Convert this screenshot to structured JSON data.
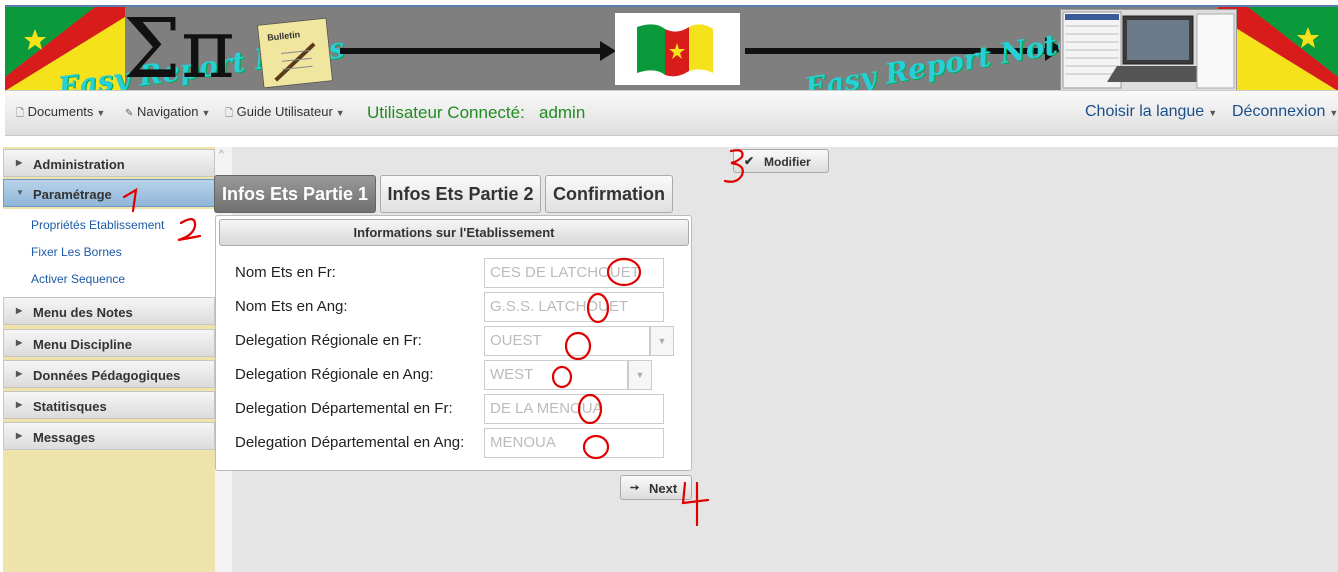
{
  "banner": {
    "title_left": "Easy Report Notes",
    "title_right": "Easy Report Notes",
    "bulletin_label": "Bulletin"
  },
  "navbar": {
    "items": [
      {
        "label": "Documents",
        "icon": "document-icon"
      },
      {
        "label": "Navigation",
        "icon": "pencil-icon"
      },
      {
        "label": "Guide Utilisateur",
        "icon": "document-icon"
      }
    ],
    "user_label": "Utilisateur Connecté:",
    "user_name": "admin",
    "language_label": "Choisir la langue",
    "logout_label": "Déconnexion"
  },
  "sidebar": {
    "sections": [
      {
        "label": "Administration"
      },
      {
        "label": "Paramétrage",
        "active": true
      },
      {
        "label": "Menu des Notes"
      },
      {
        "label": "Menu Discipline"
      },
      {
        "label": "Données Pédagogiques"
      },
      {
        "label": "Statitisques"
      },
      {
        "label": "Messages"
      }
    ],
    "sub_items": [
      {
        "label": "Propriétés Etablissement"
      },
      {
        "label": "Fixer Les Bornes"
      },
      {
        "label": "Activer Sequence"
      }
    ]
  },
  "main": {
    "modify_label": "Modifier",
    "tabs": [
      {
        "label": "Infos Ets Partie 1",
        "active": true
      },
      {
        "label": "Infos Ets Partie 2"
      },
      {
        "label": "Confirmation"
      }
    ],
    "panel_title": "Informations sur l'Etablissement",
    "fields": [
      {
        "label": "Nom Ets en Fr:",
        "value": "CES DE LATCHOUET"
      },
      {
        "label": "Nom Ets en Ang:",
        "value": "G.S.S. LATCHOUET"
      },
      {
        "label": "Delegation Régionale en Fr:",
        "value": "OUEST"
      },
      {
        "label": "Delegation Régionale en Ang:",
        "value": "WEST"
      },
      {
        "label": "Delegation Départemental en Fr:",
        "value": "DE LA MENOUA"
      },
      {
        "label": "Delegation Départemental en Ang:",
        "value": "MENOUA"
      }
    ],
    "next_label": "Next"
  },
  "annotations": {
    "step1": "1",
    "step2": "2",
    "step3": "3",
    "step4": "4",
    "color": "#e00000"
  },
  "colors": {
    "banner_text": "#26d0d6",
    "user_text": "#228b22",
    "link_text": "#1a5aa6",
    "sidebar_bg": "#ede3ab",
    "active_tab": "#7f7f7f"
  }
}
